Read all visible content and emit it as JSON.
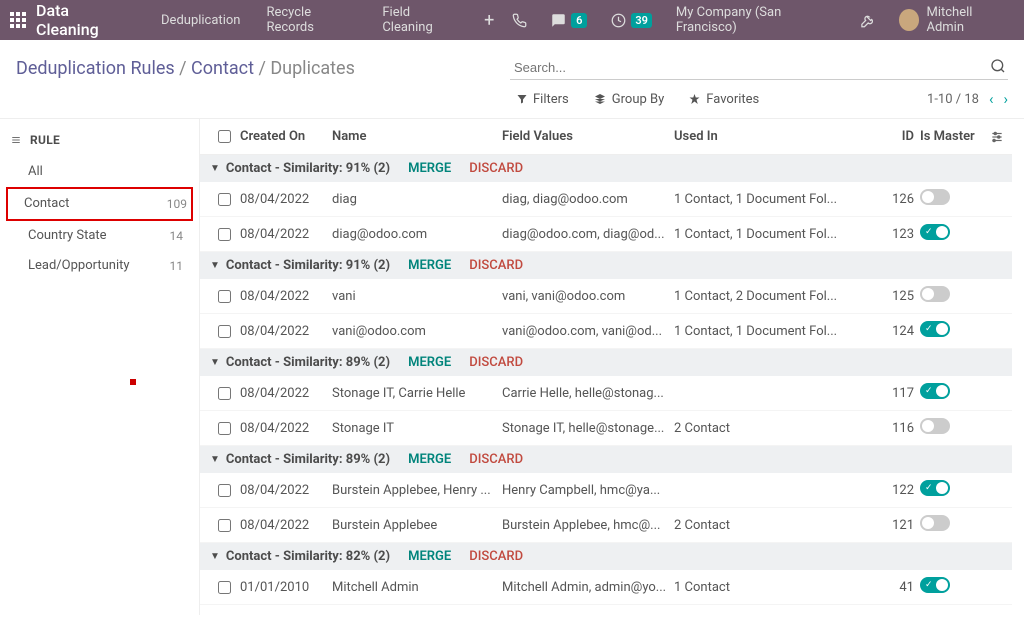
{
  "navbar": {
    "title": "Data Cleaning",
    "items": [
      "Deduplication",
      "Recycle Records",
      "Field Cleaning"
    ],
    "msg_count": "6",
    "clock_count": "39",
    "company": "My Company (San Francisco)",
    "user": "Mitchell Admin"
  },
  "breadcrumb": {
    "a": "Deduplication Rules",
    "b": "Contact",
    "c": "Duplicates"
  },
  "search": {
    "placeholder": "Search..."
  },
  "filters": {
    "filters": "Filters",
    "groupby": "Group By",
    "favorites": "Favorites"
  },
  "pager": {
    "range": "1-10 / 18"
  },
  "sidebar": {
    "heading": "RULE",
    "items": [
      {
        "label": "All",
        "count": ""
      },
      {
        "label": "Contact",
        "count": "109",
        "highlight": true
      },
      {
        "label": "Country State",
        "count": "14"
      },
      {
        "label": "Lead/Opportunity",
        "count": "11"
      }
    ]
  },
  "columns": {
    "created": "Created On",
    "name": "Name",
    "field": "Field Values",
    "used": "Used In",
    "id": "ID",
    "master": "Is Master"
  },
  "group_actions": {
    "merge": "MERGE",
    "discard": "DISCARD"
  },
  "groups": [
    {
      "title": "Contact - Similarity: 91% (2)",
      "rows": [
        {
          "created": "08/04/2022",
          "name": "diag",
          "field": "diag, diag@odoo.com",
          "used": "1 Contact, 1 Document Fol...",
          "id": "126",
          "master": false
        },
        {
          "created": "08/04/2022",
          "name": "diag@odoo.com",
          "field": "diag@odoo.com, diag@od...",
          "used": "1 Contact, 1 Document Fol...",
          "id": "123",
          "master": true
        }
      ]
    },
    {
      "title": "Contact - Similarity: 91% (2)",
      "rows": [
        {
          "created": "08/04/2022",
          "name": "vani",
          "field": "vani, vani@odoo.com",
          "used": "1 Contact, 2 Document Fol...",
          "id": "125",
          "master": false
        },
        {
          "created": "08/04/2022",
          "name": "vani@odoo.com",
          "field": "vani@odoo.com, vani@od...",
          "used": "1 Contact, 1 Document Fol...",
          "id": "124",
          "master": true
        }
      ]
    },
    {
      "title": "Contact - Similarity: 89% (2)",
      "rows": [
        {
          "created": "08/04/2022",
          "name": "Stonage IT, Carrie Helle",
          "field": "Carrie Helle, helle@stonag...",
          "used": "",
          "id": "117",
          "master": true
        },
        {
          "created": "08/04/2022",
          "name": "Stonage IT",
          "field": "Stonage IT, helle@stonage...",
          "used": "2 Contact",
          "id": "116",
          "master": false
        }
      ]
    },
    {
      "title": "Contact - Similarity: 89% (2)",
      "rows": [
        {
          "created": "08/04/2022",
          "name": "Burstein Applebee, Henry ...",
          "field": "Henry Campbell, hmc@ya...",
          "used": "",
          "id": "122",
          "master": true
        },
        {
          "created": "08/04/2022",
          "name": "Burstein Applebee",
          "field": "Burstein Applebee, hmc@...",
          "used": "2 Contact",
          "id": "121",
          "master": false
        }
      ]
    },
    {
      "title": "Contact - Similarity: 82% (2)",
      "rows": [
        {
          "created": "01/01/2010",
          "name": "Mitchell Admin",
          "field": "Mitchell Admin, admin@yo...",
          "used": "1 Contact",
          "id": "41",
          "master": true
        }
      ]
    }
  ]
}
